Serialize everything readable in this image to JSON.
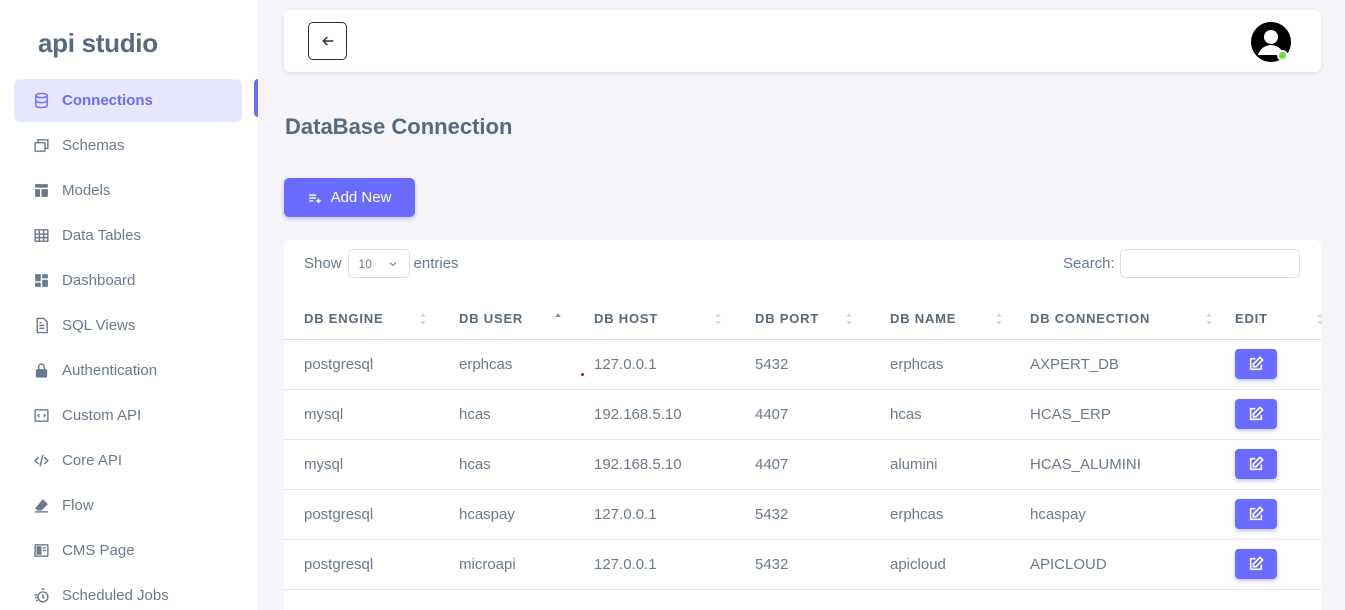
{
  "brand": "api studio",
  "sidebar": {
    "items": [
      {
        "label": "Connections",
        "icon": "database-icon",
        "active": true
      },
      {
        "label": "Schemas",
        "icon": "windows-icon"
      },
      {
        "label": "Models",
        "icon": "layout-icon"
      },
      {
        "label": "Data Tables",
        "icon": "table-icon"
      },
      {
        "label": "Dashboard",
        "icon": "dashboard-icon"
      },
      {
        "label": "SQL Views",
        "icon": "file-icon"
      },
      {
        "label": "Authentication",
        "icon": "lock-icon"
      },
      {
        "label": "Custom API",
        "icon": "code-box-icon"
      },
      {
        "label": "Core API",
        "icon": "code-icon"
      },
      {
        "label": "Flow",
        "icon": "eraser-icon"
      },
      {
        "label": "CMS Page",
        "icon": "book-icon"
      },
      {
        "label": "Scheduled Jobs",
        "icon": "timer-icon"
      }
    ]
  },
  "navbar": {
    "back_icon": "arrow-left-icon",
    "avatar_icon": "user-avatar-icon",
    "status_color": "#71dd37"
  },
  "page": {
    "title": "DataBase Connection",
    "add_label": "Add New"
  },
  "table": {
    "show_label": "Show",
    "page_size": "10",
    "entries_label": "entries",
    "search_label": "Search:",
    "search_value": "",
    "headers": [
      "DB ENGINE",
      "DB USER",
      "DB HOST",
      "DB PORT",
      "DB NAME",
      "DB CONNECTION",
      "EDIT"
    ],
    "sorted_column": 1,
    "rows": [
      [
        "postgresql",
        "erphcas",
        "127.0.0.1",
        "5432",
        "erphcas",
        "AXPERT_DB"
      ],
      [
        "mysql",
        "hcas",
        "192.168.5.10",
        "4407",
        "hcas",
        "HCAS_ERP"
      ],
      [
        "mysql",
        "hcas",
        "192.168.5.10",
        "4407",
        "alumini",
        "HCAS_ALUMINI"
      ],
      [
        "postgresql",
        "hcaspay",
        "127.0.0.1",
        "5432",
        "erphcas",
        "hcaspay"
      ],
      [
        "postgresql",
        "microapi",
        "127.0.0.1",
        "5432",
        "apicloud",
        "APICLOUD"
      ]
    ]
  },
  "colors": {
    "accent": "#696cff",
    "accent_light": "#e7e7ff",
    "heading": "#566a7f",
    "text": "#697a8d",
    "background": "#f5f5f9"
  }
}
